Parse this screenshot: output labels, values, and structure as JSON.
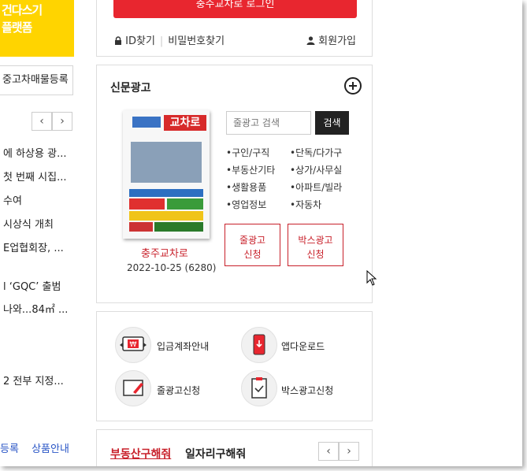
{
  "left": {
    "banner_line1": "건다스기",
    "banner_line2": "플랫폼",
    "used_car_button": "중고차매물등록",
    "news_items": [
      "에 하상용 광...",
      "첫 번째 시집...",
      "수여",
      "시상식 개최",
      "E업협회장, ...",
      "l ‘GQC’ 출범",
      "나와...84㎡ ...",
      "2 전부 지정..."
    ],
    "bottom_links": [
      "등록",
      "상품안내"
    ]
  },
  "login": {
    "login_button": "충주교차로 로그인",
    "find_id": "ID찾기",
    "find_password": "비밀번호찾기",
    "join": "회원가입"
  },
  "newspaper": {
    "title": "신문광고",
    "paper_logo": "교차로",
    "paper_name": "충주교차로",
    "paper_date": "2022-10-25 (6280)",
    "search_placeholder": "줄광고 검색",
    "search_button": "검색",
    "categories": [
      "•구인/구직",
      "•단독/다가구",
      "•부동산기타",
      "•상가/사무실",
      "•생활용품",
      "•아파트/빌라",
      "•영업정보",
      "•자동차"
    ],
    "line_ad_button": [
      "줄광고",
      "신청"
    ],
    "box_ad_button": [
      "박스광고",
      "신청"
    ]
  },
  "services": {
    "items": [
      {
        "label": "입금계좌안내",
        "icon": "bank-transfer-icon"
      },
      {
        "label": "앱다운로드",
        "icon": "mobile-download-icon"
      },
      {
        "label": "줄광고신청",
        "icon": "edit-monitor-icon"
      },
      {
        "label": "박스광고신청",
        "icon": "clipboard-check-icon"
      }
    ]
  },
  "tabs": {
    "tab1": "부동산구해줘",
    "tab2": "일자리구해줘"
  },
  "colors": {
    "accent_red": "#e8262f",
    "brand_yellow": "#ffd400",
    "dark": "#222222"
  }
}
